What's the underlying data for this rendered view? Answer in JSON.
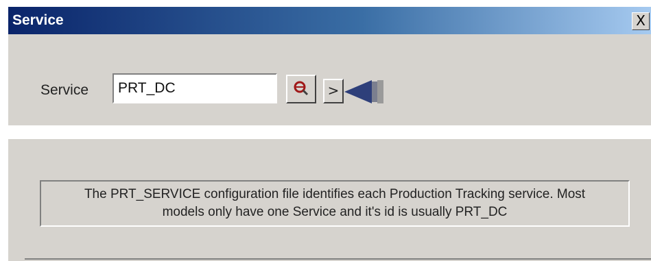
{
  "window": {
    "title": "Service",
    "close_label": "X"
  },
  "form": {
    "service_label": "Service",
    "service_value": "PRT_DC",
    "go_label": ">"
  },
  "info": {
    "line1": "The PRT_SERVICE configuration file identifies each Production Tracking service.  Most",
    "line2": "models only have one Service and it's id is usually PRT_DC"
  },
  "icons": {
    "search": "search-icon",
    "pointer": "arrow-pointer-icon",
    "close": "close-icon"
  },
  "colors": {
    "titlebar_start": "#0a246a",
    "titlebar_end": "#a6caf0",
    "dialog_bg": "#d6d3ce",
    "arrow": "#2e3f7a"
  }
}
